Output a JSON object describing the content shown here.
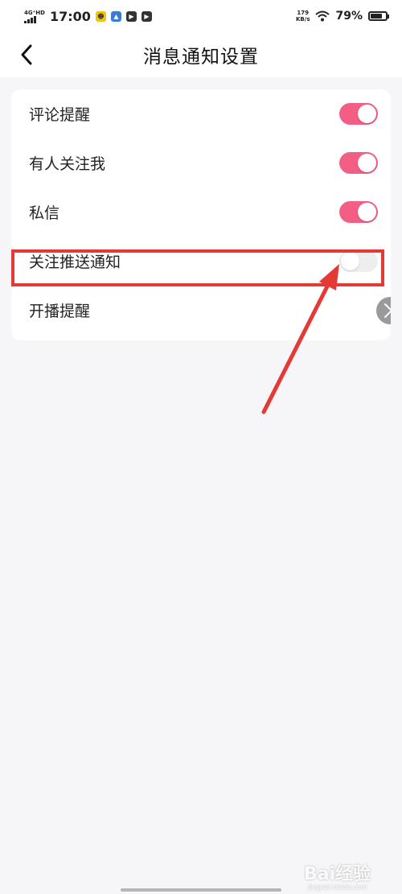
{
  "status_bar": {
    "network": "4G⁺HD",
    "time": "17:00",
    "speed_value": "179",
    "speed_unit": "KB/s",
    "battery_percent": "79%",
    "battery_level": 0.79
  },
  "header": {
    "title": "消息通知设置",
    "back_icon": "chevron-left-icon"
  },
  "settings": [
    {
      "label": "评论提醒",
      "control": "toggle",
      "on": true
    },
    {
      "label": "有人关注我",
      "control": "toggle",
      "on": true
    },
    {
      "label": "私信",
      "control": "toggle",
      "on": true
    },
    {
      "label": "关注推送通知",
      "control": "toggle",
      "on": false
    },
    {
      "label": "开播提醒",
      "control": "chevron",
      "icon": "chevron-right-icon"
    }
  ],
  "colors": {
    "toggle_on": "#f25e84",
    "toggle_off": "#eeeeee",
    "annotation": "#e53935"
  },
  "watermark": {
    "logo": "Bai经验",
    "sub": "jingyan.baidu.com"
  }
}
